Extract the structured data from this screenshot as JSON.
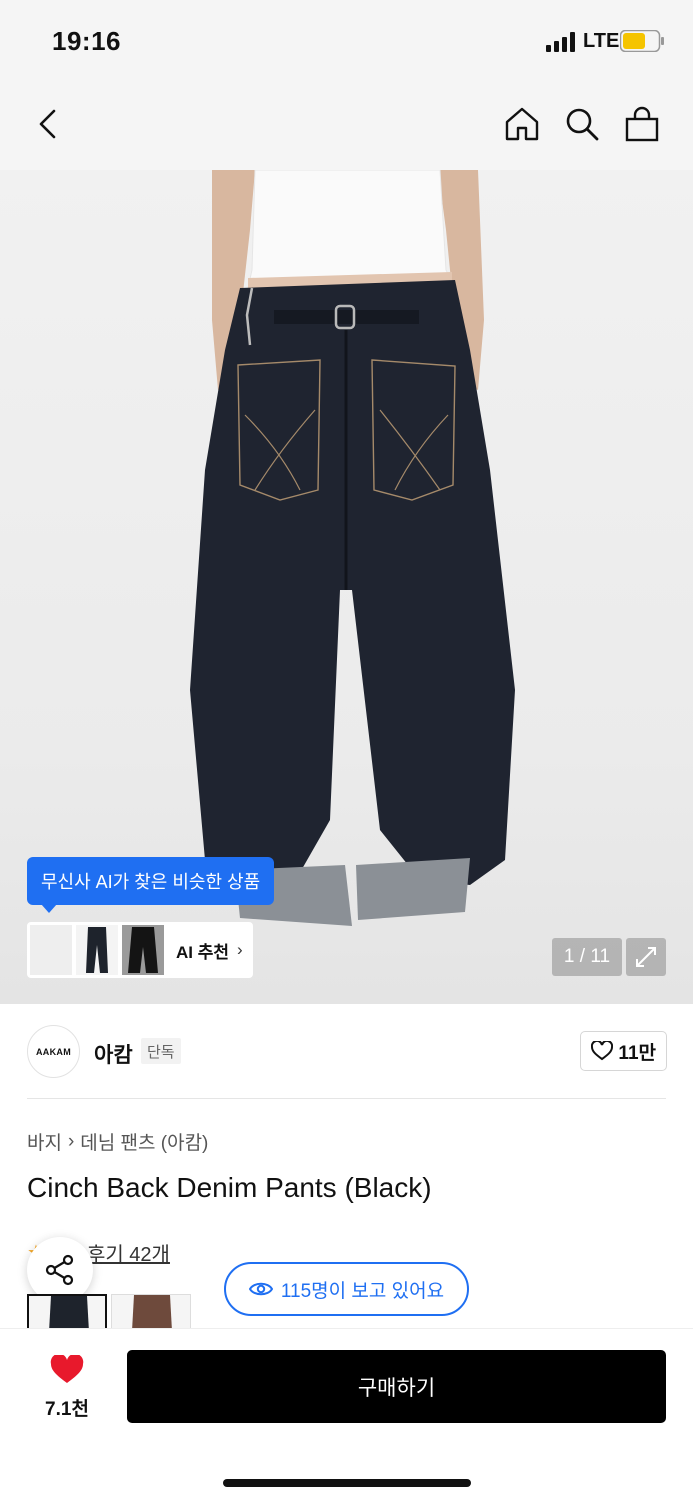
{
  "status_bar": {
    "time": "19:16",
    "network": "LTE",
    "battery_color": "#f5c400"
  },
  "nav": {
    "icons": [
      "back-arrow-icon",
      "home-icon",
      "search-icon",
      "shopping-bag-icon"
    ]
  },
  "hero": {
    "ai_tooltip": "무신사 AI가 찾은 비슷한 상품",
    "ai_label": "AI 추천",
    "ai_chevron": "›",
    "counter": "1 / 11",
    "expand_icon": "expand-icon"
  },
  "brand": {
    "logo_text": "AAKAM",
    "name": "아캄",
    "badge": "단독",
    "like_count": "11만"
  },
  "breadcrumb": {
    "level1": "바지",
    "separator": "›",
    "level2": "데님 팬츠 (아캄)"
  },
  "product": {
    "title": "Cinch Back Denim Pants (Black)"
  },
  "reviews": {
    "link": "후기 42개"
  },
  "viewers": {
    "text": "115명이 보고 있어요"
  },
  "bottom_bar": {
    "wish_count": "7.1천",
    "buy_label": "구매하기",
    "accent": "#e8192c"
  },
  "colors": {
    "accent_blue": "#1f6ff2",
    "button_black": "#000000"
  }
}
